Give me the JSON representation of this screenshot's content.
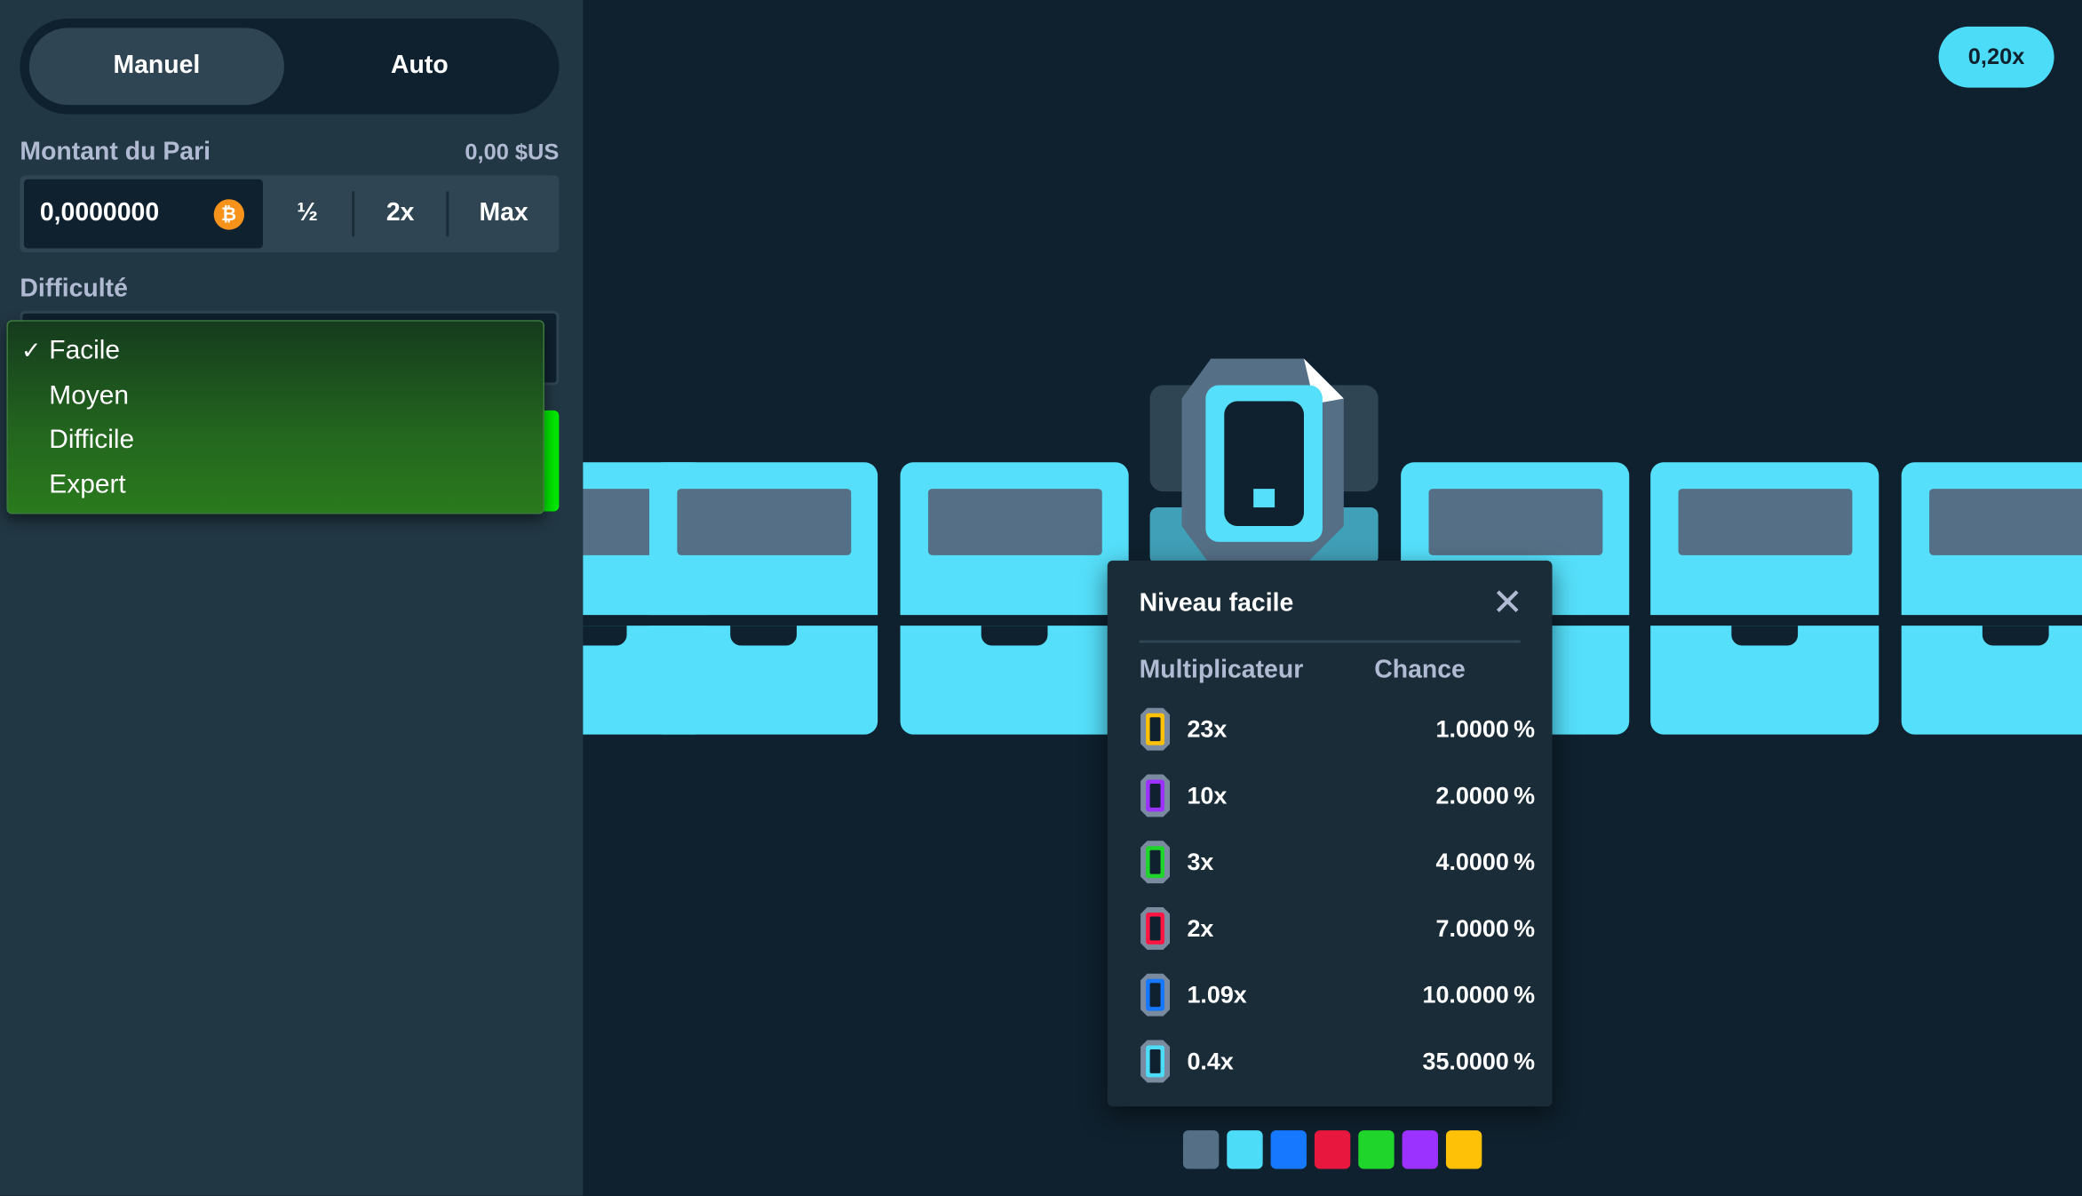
{
  "mode_toggle": {
    "manual": "Manuel",
    "auto": "Auto"
  },
  "bet": {
    "label": "Montant du Pari",
    "balance": "0,00 $US",
    "value": "0,0000000",
    "currency_icon": "bitcoin-icon",
    "half": "½",
    "double": "2x",
    "max": "Max"
  },
  "difficulty": {
    "label": "Difficulté",
    "selected": "Facile",
    "options": [
      "Facile",
      "Moyen",
      "Difficile",
      "Expert"
    ]
  },
  "game": {
    "multiplier_pill": "0,20x"
  },
  "popup": {
    "title": "Niveau facile",
    "col_multiplier": "Multiplicateur",
    "col_chance": "Chance",
    "rows": [
      {
        "mult": "23x",
        "chance": "1.0000 %",
        "color": "#ffc107"
      },
      {
        "mult": "10x",
        "chance": "2.0000 %",
        "color": "#9c32ff"
      },
      {
        "mult": "3x",
        "chance": "4.0000 %",
        "color": "#1fd42a"
      },
      {
        "mult": "2x",
        "chance": "7.0000 %",
        "color": "#ff1744"
      },
      {
        "mult": "1.09x",
        "chance": "10.0000 %",
        "color": "#1677ff"
      },
      {
        "mult": "0.4x",
        "chance": "35.0000 %",
        "color": "#4ddcf8"
      }
    ]
  },
  "swatches": [
    "#557086",
    "#4ddcf8",
    "#1677ff",
    "#e7173d",
    "#1fd42a",
    "#9c32ff",
    "#ffc107"
  ]
}
